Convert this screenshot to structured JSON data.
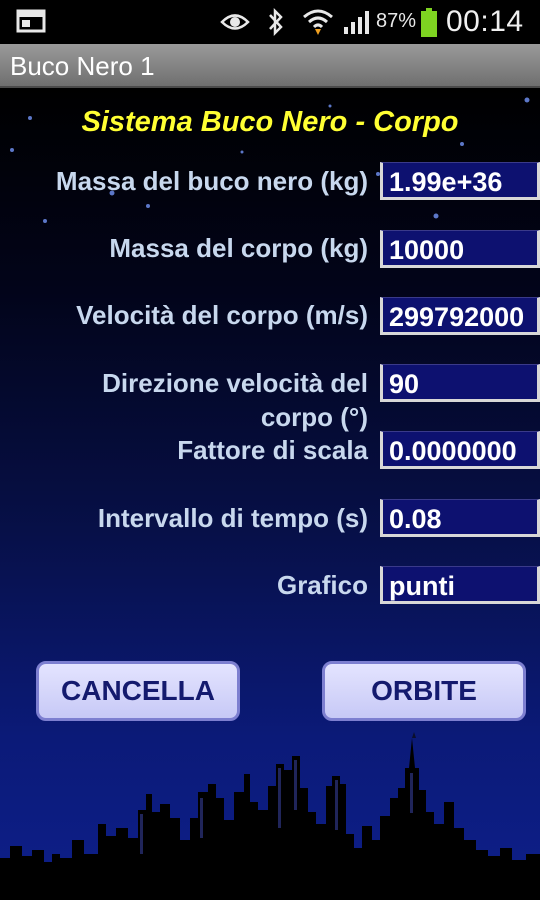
{
  "status": {
    "battery_percent": "87%",
    "time": "00:14",
    "icons": [
      "screenshot-icon",
      "eye-icon",
      "bluetooth-icon",
      "wifi-icon",
      "signal-icon",
      "battery-icon"
    ]
  },
  "app": {
    "title": "Buco Nero 1"
  },
  "heading": "Sistema Buco Nero - Corpo",
  "fields": [
    {
      "label": "Massa del buco nero (kg)",
      "value": "1.99e+36"
    },
    {
      "label": "Massa del corpo (kg)",
      "value": "10000"
    },
    {
      "label": "Velocità del corpo (m/s)",
      "value": "299792000"
    },
    {
      "label": "Direzione velocità del corpo (°)",
      "value": "90"
    },
    {
      "label": "Fattore di scala",
      "value": "0.0000000"
    },
    {
      "label": "Intervallo di tempo (s)",
      "value": "0.08"
    },
    {
      "label": "Grafico",
      "value": "punti"
    }
  ],
  "buttons": {
    "cancel": "CANCELLA",
    "orbits": "ORBITE"
  },
  "colors": {
    "heading": "#ffff33",
    "label": "#c8d8ee",
    "field_bg": "#0d1170",
    "button_text": "#141a6e",
    "battery_fill": "#7ed321"
  }
}
